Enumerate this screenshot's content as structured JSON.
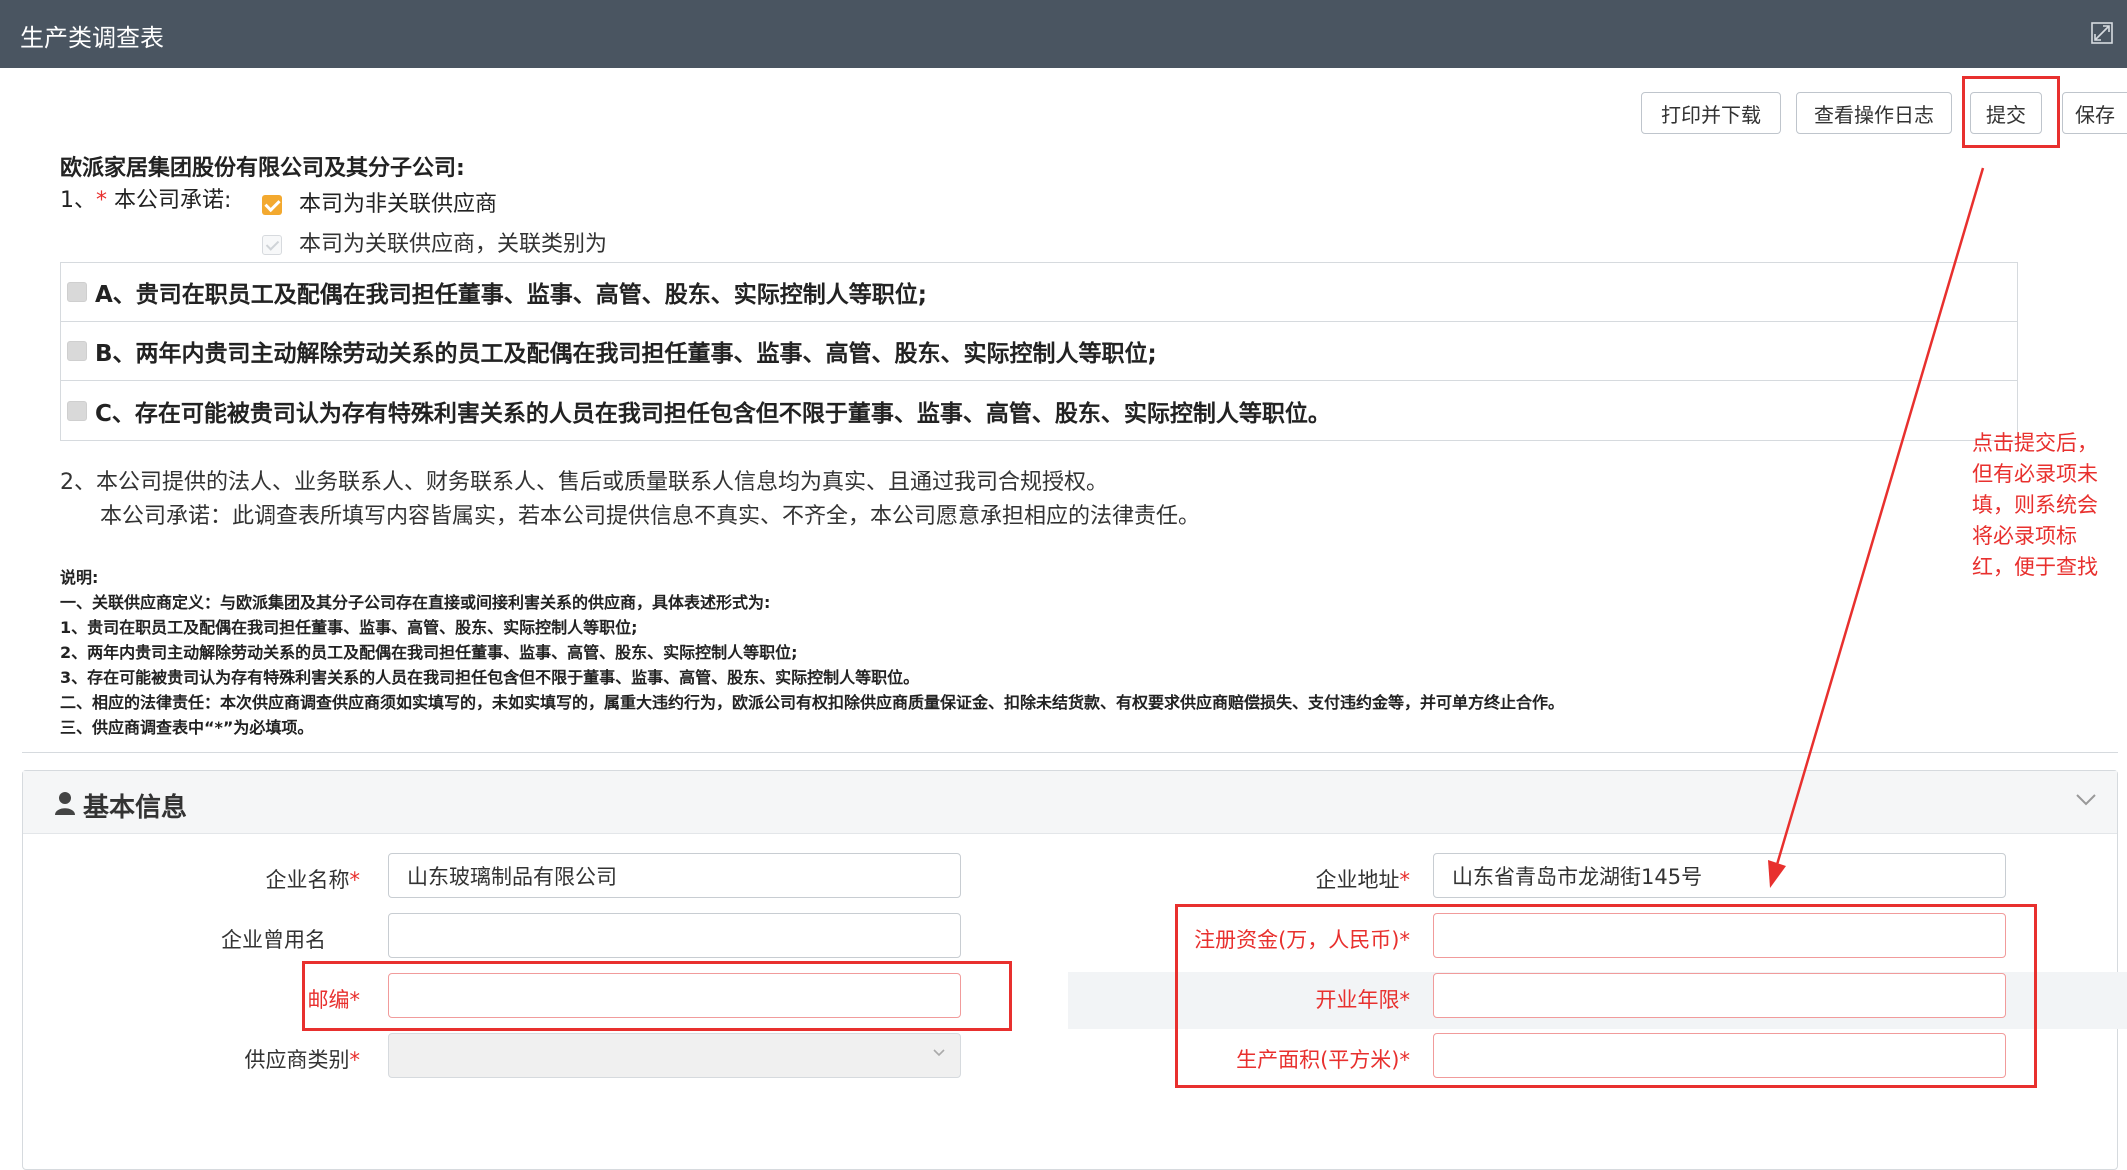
{
  "window": {
    "title": "生产类调查表",
    "expand_icon": "expand-icon"
  },
  "toolbar": {
    "print": "打印并下载",
    "log": "查看操作日志",
    "submit": "提交",
    "save": "保存"
  },
  "commitment": {
    "company": "欧派家居集团股份有限公司及其分子公司:",
    "item1_prefix": "1、",
    "item1_star": "*",
    "item1_label": "本公司承诺:",
    "opt_non_related": "本司为非关联供应商",
    "opt_related": "本司为关联供应商，关联类别为",
    "options": [
      "A、贵司在职员工及配偶在我司担任董事、监事、高管、股东、实际控制人等职位;",
      "B、两年内贵司主动解除劳动关系的员工及配偶在我司担任董事、监事、高管、股东、实际控制人等职位;",
      "C、存在可能被贵司认为存有特殊利害关系的人员在我司担任包含但不限于董事、监事、高管、股东、实际控制人等职位。"
    ],
    "item2": "2、本公司提供的法人、业务联系人、财务联系人、售后或质量联系人信息均为真实、且通过我司合规授权。",
    "item2_sub": "本公司承诺：此调查表所填写内容皆属实，若本公司提供信息不真实、不齐全，本公司愿意承担相应的法律责任。"
  },
  "notes": [
    "说明:",
    "一、关联供应商定义：与欧派集团及其分子公司存在直接或间接利害关系的供应商，具体表述形式为:",
    "1、贵司在职员工及配偶在我司担任董事、监事、高管、股东、实际控制人等职位;",
    "2、两年内贵司主动解除劳动关系的员工及配偶在我司担任董事、监事、高管、股东、实际控制人等职位;",
    "3、存在可能被贵司认为存有特殊利害关系的人员在我司担任包含但不限于董事、监事、高管、股东、实际控制人等职位。",
    "二、相应的法律责任：本次供应商调查供应商须如实填写的，未如实填写的，属重大违约行为，欧派公司有权扣除供应商质量保证金、扣除未结货款、有权要求供应商赔偿损失、支付违约金等，并可单方终止合作。",
    "三、供应商调查表中“*”为必填项。"
  ],
  "annotation": [
    "点击提交后，",
    "但有必录项未",
    "填，则系统会",
    "将必录项标",
    "红，便于查找"
  ],
  "basic_info": {
    "title": "基本信息",
    "star": "*",
    "fields": {
      "company_name": {
        "label": "企业名称",
        "value": "山东玻璃制品有限公司"
      },
      "former_name": {
        "label": "企业曾用名",
        "value": ""
      },
      "postcode": {
        "label": "邮编",
        "value": ""
      },
      "supplier_type": {
        "label": "供应商类别",
        "value": ""
      },
      "address": {
        "label": "企业地址",
        "value": "山东省青岛市龙湖街145号"
      },
      "capital": {
        "label": "注册资金(万，人民币)",
        "value": ""
      },
      "years": {
        "label": "开业年限",
        "value": ""
      },
      "area": {
        "label": "生产面积(平方米)",
        "value": ""
      }
    }
  }
}
